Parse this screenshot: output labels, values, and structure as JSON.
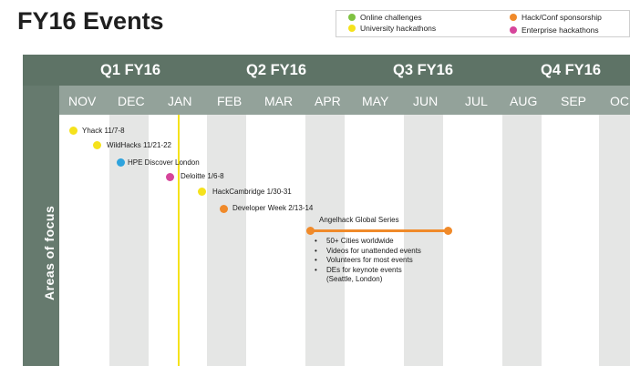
{
  "title": "FY16 Events",
  "legend": {
    "items": [
      {
        "label": "Online challenges",
        "color": "#7fc241"
      },
      {
        "label": "University hackathons",
        "color": "#f5e21c"
      },
      {
        "label": "Hack/Conf sponsorship",
        "color": "#f08a2a"
      },
      {
        "label": "Enterprise hackathons",
        "color": "#d6459b"
      }
    ]
  },
  "quarters": [
    "Q1 FY16",
    "Q2 FY16",
    "Q3 FY16",
    "Q4 FY16"
  ],
  "months": [
    "NOV",
    "DEC",
    "JAN",
    "FEB",
    "MAR",
    "APR",
    "MAY",
    "JUN",
    "JUL",
    "AUG",
    "SEP",
    "OC"
  ],
  "side_label": "Areas of focus",
  "events": [
    {
      "label": "Yhack 11/7-8",
      "color": "#f5e21c"
    },
    {
      "label": "WildHacks 11/21-22",
      "color": "#f5e21c"
    },
    {
      "label": "HPE Discover London",
      "color": "#2ea3dd"
    },
    {
      "label": "Deloitte 1/6-8",
      "color": "#d6459b"
    },
    {
      "label": "HackCambridge 1/30-31",
      "color": "#f5e21c"
    },
    {
      "label": "Developer Week 2/13-14",
      "color": "#f08a2a"
    }
  ],
  "series": {
    "title": "Angelhack Global Series",
    "color": "#f08a2a",
    "bullets": [
      "50+ Cities worldwide",
      "Videos for unattended events",
      "Volunteers for most events",
      "DEs for keynote events",
      "(Seattle, London)"
    ]
  }
}
